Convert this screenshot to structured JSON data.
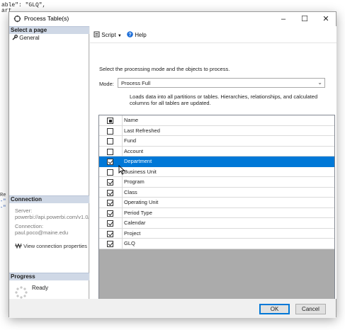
{
  "background": {
    "code_lines": [
      "able\": \"GLQ\",",
      "art"
    ],
    "side_fragments": [
      "Re",
      "-\"",
      "-\""
    ]
  },
  "dialog": {
    "title": "Process Table(s)",
    "window_buttons": {
      "minimize": "–",
      "maximize": "☐",
      "close": "✕"
    }
  },
  "left_pane": {
    "select_page_header": "Select a page",
    "pages": [
      "General"
    ],
    "connection_header": "Connection",
    "server_label": "Server:",
    "server_value": "powerbi://api.powerbi.com/v1.0/m",
    "connection_label": "Connection:",
    "connection_value": "paul.poco@maine.edu",
    "view_connection_link": "View connection properties",
    "progress_header": "Progress",
    "progress_status": "Ready"
  },
  "toolbar": {
    "script_label": "Script",
    "help_label": "Help"
  },
  "main": {
    "instruction": "Select the processing mode and the objects to process.",
    "mode_label": "Mode:",
    "mode_value": "Process Full",
    "description": "Loads data into all partitions or tables. Hierarchies, relationships, and calculated columns for all tables are updated.",
    "grid_header": "Name",
    "tables": [
      {
        "name": "Last Refreshed",
        "checked": false
      },
      {
        "name": "Fund",
        "checked": false
      },
      {
        "name": "Account",
        "checked": false
      },
      {
        "name": "Department",
        "checked": true,
        "selected": true
      },
      {
        "name": "Business Unit",
        "checked": false
      },
      {
        "name": "Program",
        "checked": true
      },
      {
        "name": "Class",
        "checked": true
      },
      {
        "name": "Operating Unit",
        "checked": true
      },
      {
        "name": "Period Type",
        "checked": true
      },
      {
        "name": "Calendar",
        "checked": true
      },
      {
        "name": "Project",
        "checked": true
      },
      {
        "name": "GLQ",
        "checked": true
      }
    ]
  },
  "footer": {
    "ok_label": "OK",
    "cancel_label": "Cancel"
  },
  "colors": {
    "selection": "#0078d7",
    "section_header": "#cfd8e6",
    "grid_empty": "#ababab"
  }
}
